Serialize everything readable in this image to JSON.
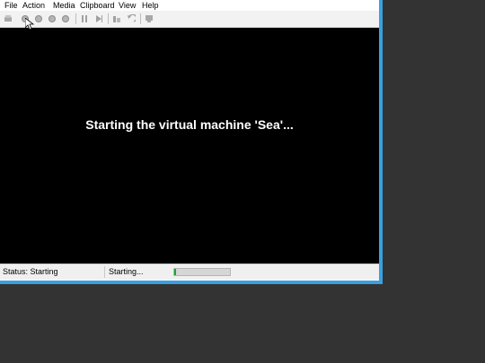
{
  "menu": {
    "items": [
      "File",
      "Action",
      "Media",
      "Clipboard",
      "View",
      "Help"
    ]
  },
  "toolbar": {
    "buttons": [
      "ctrl-alt-del-icon",
      "start-icon",
      "turn-off-icon",
      "shut-down-icon",
      "save-icon",
      "pause-icon",
      "reset-icon",
      "checkpoint-icon",
      "revert-icon",
      "enhanced-session-icon"
    ]
  },
  "screen": {
    "message": "Starting the virtual machine 'Sea'..."
  },
  "status": {
    "text": "Status: Starting",
    "progress_label": "Starting...",
    "progress_fraction": 0.03
  },
  "colors": {
    "accent": "#3aa0e0",
    "screen_bg": "#000000",
    "progress_fill": "#06b025"
  }
}
